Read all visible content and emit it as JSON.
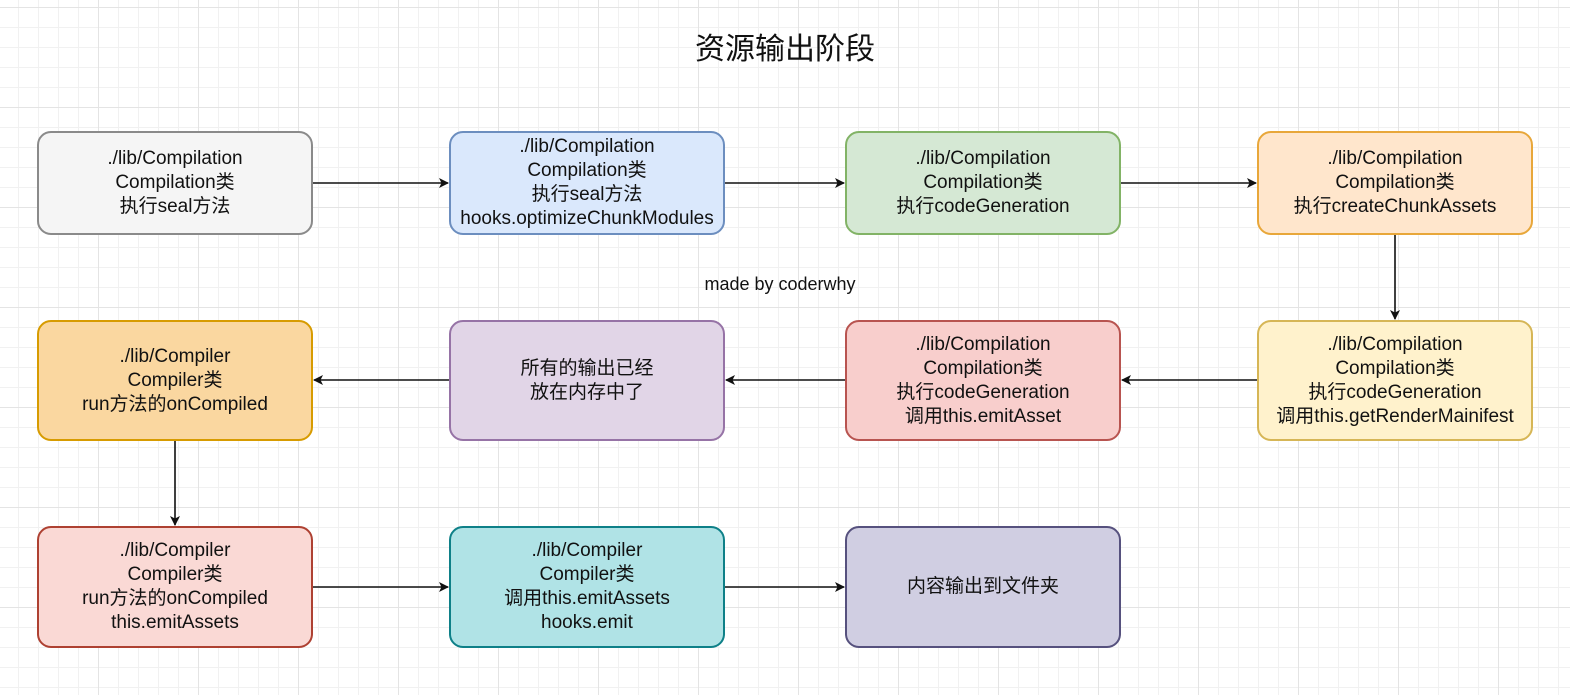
{
  "title": "资源输出阶段",
  "watermark": "made by coderwhy",
  "nodes": [
    {
      "id": "n1",
      "text": "./lib/Compilation\nCompilation类\n执行seal方法",
      "fill": "#f5f5f5",
      "stroke": "#8a8a8a"
    },
    {
      "id": "n2",
      "text": "./lib/Compilation\nCompilation类\n执行seal方法\nhooks.optimizeChunkModules",
      "fill": "#dae8fc",
      "stroke": "#6c8ebf"
    },
    {
      "id": "n3",
      "text": "./lib/Compilation\nCompilation类\n执行codeGeneration",
      "fill": "#d5e8d4",
      "stroke": "#82b366"
    },
    {
      "id": "n4",
      "text": "./lib/Compilation\nCompilation类\n执行createChunkAssets",
      "fill": "#ffe6cc",
      "stroke": "#e8a73a"
    },
    {
      "id": "n5",
      "text": "./lib/Compilation\nCompilation类\n执行codeGeneration\n调用this.getRenderMainifest",
      "fill": "#fff2cc",
      "stroke": "#d6b656"
    },
    {
      "id": "n6",
      "text": "./lib/Compilation\nCompilation类\n执行codeGeneration\n调用this.emitAsset",
      "fill": "#f8cecc",
      "stroke": "#b85450"
    },
    {
      "id": "n7",
      "text": "所有的输出已经\n放在内存中了",
      "fill": "#e1d5e7",
      "stroke": "#9673a6"
    },
    {
      "id": "n8",
      "text": "./lib/Compiler\nCompiler类\nrun方法的onCompiled",
      "fill": "#fad7a0",
      "stroke": "#d79b00"
    },
    {
      "id": "n9",
      "text": "./lib/Compiler\nCompiler类\nrun方法的onCompiled\nthis.emitAssets",
      "fill": "#fad9d5",
      "stroke": "#ae4132"
    },
    {
      "id": "n10",
      "text": "./lib/Compiler\nCompiler类\n调用this.emitAssets\nhooks.emit",
      "fill": "#b0e3e6",
      "stroke": "#0e8088"
    },
    {
      "id": "n11",
      "text": "内容输出到文件夹",
      "fill": "#d0cee2",
      "stroke": "#56517e"
    }
  ]
}
